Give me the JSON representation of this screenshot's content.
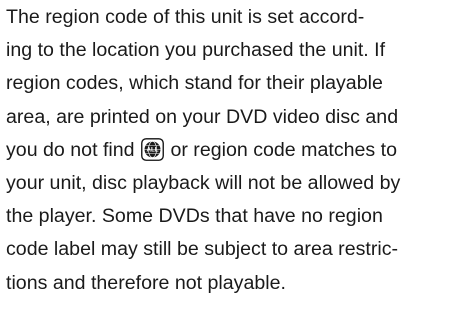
{
  "paragraph": {
    "line_1": "The region code of this unit is set accord-",
    "line_2": "ing to the location you purchased the unit. If",
    "line_3": "region codes, which stand for their playable",
    "line_4": "area, are printed on your DVD video disc and",
    "line_5_before_icon": "you do not find",
    "line_5_after_icon": " or region code matches to",
    "line_6": "your unit, disc playback will not be allowed by",
    "line_7": "the player. Some DVDs that have no region",
    "line_8": "code label may still be subject to area restric-",
    "line_9": "tions and therefore not playable."
  },
  "icon": {
    "name": "region-all-globe-icon",
    "label": "ALL"
  }
}
